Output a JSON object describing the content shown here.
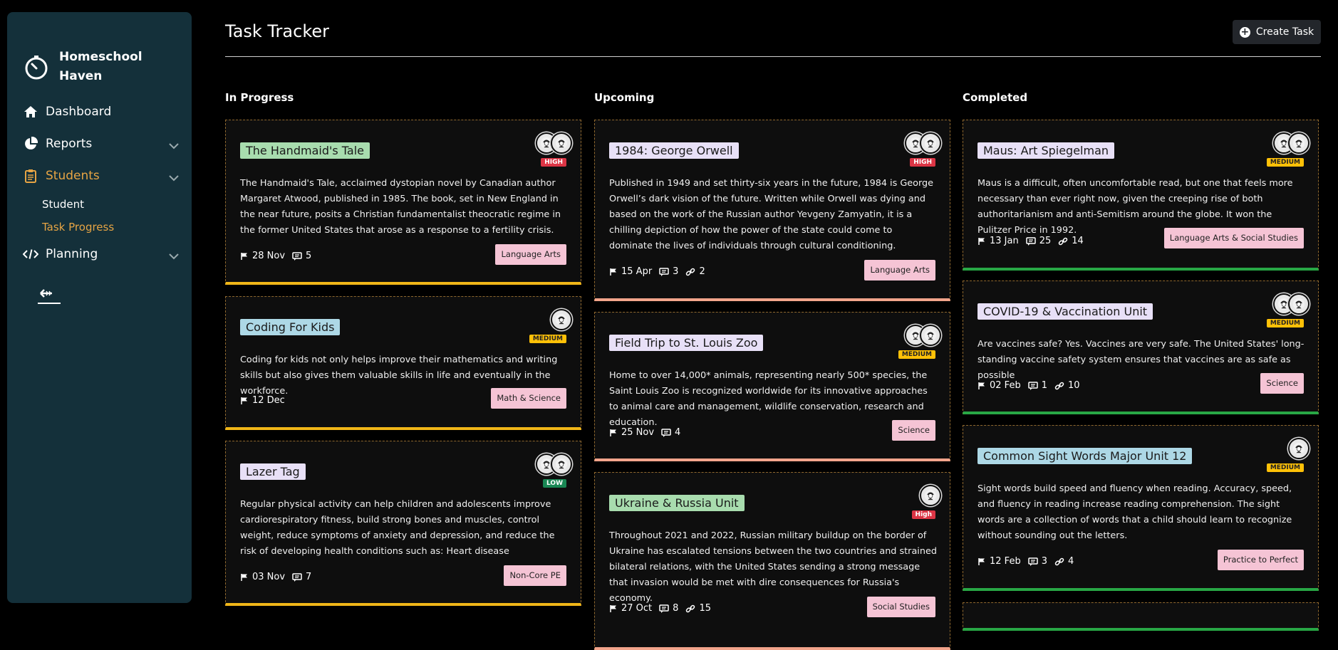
{
  "brand": {
    "name": "Homeschool Haven"
  },
  "nav": {
    "dashboard": "Dashboard",
    "reports": "Reports",
    "students": "Students",
    "student_sub": "Student",
    "task_progress_sub": "Task Progress",
    "planning": "Planning"
  },
  "header": {
    "title": "Task Tracker",
    "create_label": "Create Task"
  },
  "columns": {
    "in_progress": "In Progress",
    "upcoming": "Upcoming",
    "completed": "Completed"
  },
  "colors": {
    "sidebar_bg": "#14303a",
    "accent": "#e6a444",
    "in_progress_bar": "#f0b618",
    "upcoming_bar": "#f2a48b",
    "completed_bar": "#28a745",
    "title_green": "#a8dcae",
    "title_blue": "#add8e6",
    "title_lavender": "#e8e0f7",
    "tag_pink": "#f5c4d5"
  },
  "cards": {
    "c1": {
      "title": "The Handmaid's Tale",
      "priority": "HIGH",
      "description": "The Handmaid's Tale, acclaimed dystopian novel by Canadian author Margaret Atwood, published in 1985. The book, set in New England in the near future, posits a Christian fundamentalist theocratic regime in the former United States that arose as a response to a fertility crisis.",
      "date": "28 Nov",
      "comments": "5",
      "tag": "Language Arts"
    },
    "c2": {
      "title": "Coding For Kids",
      "priority": "MEDIUM",
      "description": "Coding for kids not only helps improve their mathematics and writing skills but also gives them valuable skills in life and eventually in the workforce.",
      "date": "12 Dec",
      "tag": "Math & Science"
    },
    "c3": {
      "title": "Lazer Tag",
      "priority": "LOW",
      "description": "Regular physical activity can help children and adolescents improve cardiorespiratory fitness, build strong bones and muscles, control weight, reduce symptoms of anxiety and depression, and reduce the risk of developing health conditions such as: Heart disease",
      "date": "03 Nov",
      "comments": "7",
      "tag": "Non-Core PE"
    },
    "u1": {
      "title": "1984: George Orwell",
      "priority": "HIGH",
      "description": "Published in 1949 and set thirty-six years in the future, 1984 is George Orwell’s dark vision of the future. Written while Orwell was dying and based on the work of the Russian author Yevgeny Zamyatin, it is a chilling depiction of how the power of the state could come to dominate the lives of individuals through cultural conditioning.",
      "date": "15 Apr",
      "comments": "3",
      "links": "2",
      "tag": "Language Arts"
    },
    "u2": {
      "title": "Field Trip to St. Louis Zoo",
      "priority": "MEDIUM",
      "description": "Home to over 14,000* animals, representing nearly 500* species, the Saint Louis Zoo is recognized worldwide for its innovative approaches to animal care and management, wildlife conservation, research and education.",
      "date": "25 Nov",
      "comments": "4",
      "tag": "Science"
    },
    "u3": {
      "title": "Ukraine & Russia Unit",
      "priority": "High",
      "description": "Throughout 2021 and 2022, Russian military buildup on the border of Ukraine has escalated tensions between the two countries and strained bilateral relations, with the United States sending a strong message that invasion would be met with dire consequences for Russia's economy.",
      "date": "27 Oct",
      "comments": "8",
      "links": "15",
      "tag": "Social Studies"
    },
    "d1": {
      "title": "Maus: Art Spiegelman",
      "priority": "MEDIUM",
      "description": "Maus is a difficult, often uncomfortable read, but one that feels more necessary than ever right now, given the creeping rise of both authoritarianism and anti-Semitism around the globe. It won the Pulitzer Price in 1992.",
      "date": "13 Jan",
      "comments": "25",
      "links": "14",
      "tag": "Language Arts & Social Studies"
    },
    "d2": {
      "title": "COVID-19 & Vaccination Unit",
      "priority": "MEDIUM",
      "description": "Are vaccines safe? Yes. Vaccines are very safe. The United States' long-standing vaccine safety system ensures that vaccines are as safe as possible",
      "date": "02 Feb",
      "comments": "1",
      "links": "10",
      "tag": "Science"
    },
    "d3": {
      "title": "Common Sight Words Major Unit 12",
      "priority": "MEDIUM",
      "description": "Sight words build speed and fluency when reading. Accuracy, speed, and fluency in reading increase reading comprehension. The sight words are a collection of words that a child should learn to recognize without sounding out the letters.",
      "date": "12 Feb",
      "comments": "3",
      "links": "4",
      "tag": "Practice to Perfect"
    }
  }
}
